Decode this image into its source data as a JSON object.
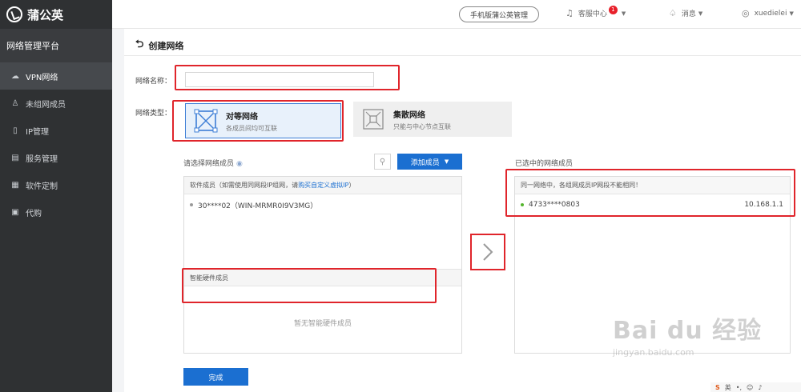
{
  "app": {
    "logo_text": "蒲公英",
    "platform_title": "网络管理平台"
  },
  "sidebar": {
    "items": [
      {
        "label": "VPN网络",
        "icon": "cloud-icon"
      },
      {
        "label": "未组网成员",
        "icon": "user-icon"
      },
      {
        "label": "IP管理",
        "icon": "ip-icon"
      },
      {
        "label": "服务管理",
        "icon": "document-icon"
      },
      {
        "label": "软件定制",
        "icon": "grid-icon"
      },
      {
        "label": "代购",
        "icon": "cart-icon"
      }
    ]
  },
  "topbar": {
    "mobile_button": "手机版蒲公英管理",
    "support": "客服中心",
    "support_badge": "1",
    "messages": "消息",
    "username": "xuedielei"
  },
  "page": {
    "title": "创建网络",
    "name_label": "网络名称：",
    "name_value": "",
    "type_label": "网络类型：",
    "types": [
      {
        "name": "对等网络",
        "desc": "各成员间均可互联"
      },
      {
        "name": "集散网络",
        "desc": "只能与中心节点互联"
      }
    ],
    "select_title": "请选择网络成员",
    "add_member_button": "添加成员",
    "software_section": {
      "prefix": "软件成员（如需使用同网段IP组网，请",
      "link": "购买自定义虚拟IP",
      "suffix": "）"
    },
    "software_members": [
      "30****02（WIN-MRMR0I9V3MG）"
    ],
    "hardware_section": "智能硬件成员",
    "hardware_empty": "暂无智能硬件成员",
    "selected_title": "已选中的网络成员",
    "selected_notice": "同一网络中，各组网成员IP网段不能相同！",
    "selected_members": [
      {
        "id": "4733****0803",
        "ip": "10.168.1.1"
      }
    ],
    "done_button": "完成"
  },
  "watermark": {
    "brand": "Bai du 经验",
    "url": "jingyan.baidu.com"
  },
  "ime_bar": {
    "label": "英"
  }
}
